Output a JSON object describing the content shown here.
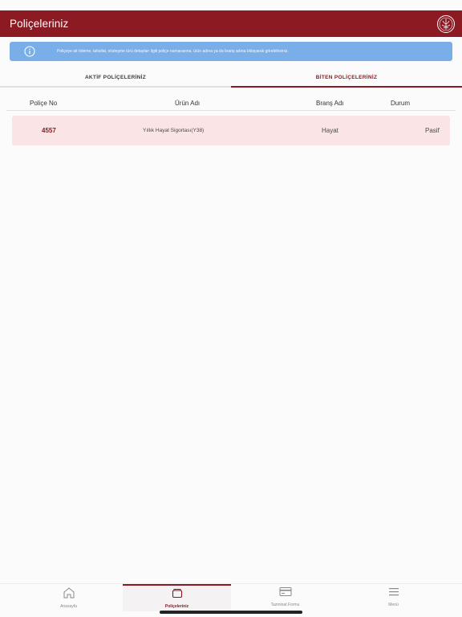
{
  "header": {
    "title": "Poliçeleriniz",
    "logo_icon": "emblem-icon"
  },
  "info_banner": {
    "icon": "info-icon",
    "text": "Poliçeye ait ödeme, tahsilat, sözleşme türü detayları ilgili poliçe numarasına, ürün adına ya da branş adına tıklayarak görebilirsiniz."
  },
  "tabs": [
    {
      "label": "AKTİF POLİÇELERİNİZ",
      "active": false
    },
    {
      "label": "BİTEN POLİÇELERİNİZ",
      "active": true
    }
  ],
  "table": {
    "columns": [
      "Poliçe No",
      "Ürün Adı",
      "Branş Adı",
      "Durum"
    ],
    "rows": [
      {
        "no": "4557",
        "name": "Yıllık Hayat Sigortası(Y38)",
        "brans": "Hayat",
        "durum": "Pasif"
      }
    ]
  },
  "bottom_nav": [
    {
      "label": "Anasayfa",
      "icon": "home-icon",
      "active": false
    },
    {
      "label": "Poliçeleriniz",
      "icon": "wallet-icon",
      "active": true
    },
    {
      "label": "Tazminat Formu",
      "icon": "card-icon",
      "active": false
    },
    {
      "label": "Menü",
      "icon": "menu-icon",
      "active": false
    }
  ],
  "colors": {
    "brand": "#8b1a22",
    "banner": "#7aaee8",
    "row_bg": "#fbe4e5"
  }
}
